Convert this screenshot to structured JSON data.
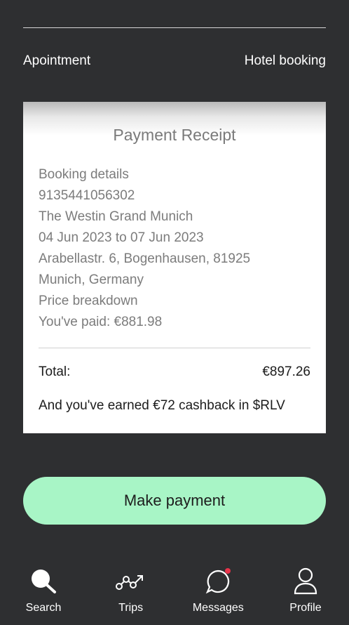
{
  "header": {
    "left_label": "Apointment",
    "right_label": "Hotel booking"
  },
  "receipt": {
    "title": "Payment Receipt",
    "lines": [
      "Booking details",
      "9135441056302",
      "The Westin Grand Munich",
      "04 Jun 2023 to 07 Jun 2023",
      "Arabellastr. 6, Bogenhausen, 81925",
      "Munich, Germany",
      "Price breakdown",
      "You've paid: €881.98"
    ],
    "total_label": "Total:",
    "total_value": "€897.26",
    "cashback_text": "And you've earned €72 cashback in $RLV"
  },
  "actions": {
    "make_payment_label": "Make payment"
  },
  "tabbar": {
    "items": [
      {
        "label": "Search",
        "icon": "search-icon"
      },
      {
        "label": "Trips",
        "icon": "trips-icon"
      },
      {
        "label": "Messages",
        "icon": "chat-bubble-icon"
      },
      {
        "label": "Profile",
        "icon": "profile-icon"
      }
    ]
  },
  "colors": {
    "background": "#2e2f31",
    "button": "#a8f5c6",
    "notification": "#e8334a"
  }
}
